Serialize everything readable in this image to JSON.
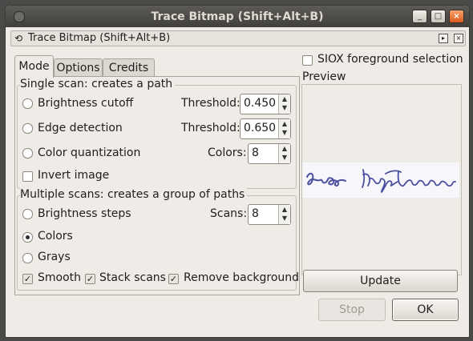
{
  "window": {
    "title": "Trace Bitmap (Shift+Alt+B)"
  },
  "titlebar_buttons": {
    "minimize": "_",
    "maximize": "□",
    "close": "×"
  },
  "dock": {
    "title": "Trace Bitmap (Shift+Alt+B)"
  },
  "tabs": [
    {
      "label": "Mode"
    },
    {
      "label": "Options"
    },
    {
      "label": "Credits"
    }
  ],
  "single_scan": {
    "title": "Single scan: creates a path",
    "brightness": {
      "label": "Brightness cutoff",
      "param_label": "Threshold:",
      "value": "0.450"
    },
    "edge": {
      "label": "Edge detection",
      "param_label": "Threshold:",
      "value": "0.650"
    },
    "color_quant": {
      "label": "Color quantization",
      "param_label": "Colors:",
      "value": "8"
    },
    "invert": {
      "label": "Invert image"
    }
  },
  "multiple_scans": {
    "title": "Multiple scans: creates a group of paths",
    "brightness_steps": {
      "label": "Brightness steps",
      "param_label": "Scans:",
      "value": "8"
    },
    "colors": {
      "label": "Colors",
      "selected": true
    },
    "grays": {
      "label": "Grays"
    },
    "smooth": {
      "label": "Smooth",
      "checked": true
    },
    "stack": {
      "label": "Stack scans",
      "checked": true
    },
    "remove_bg": {
      "label": "Remove background",
      "checked": true
    }
  },
  "siox": {
    "label": "SIOX foreground selection",
    "checked": false
  },
  "preview": {
    "title": "Preview",
    "update_label": "Update"
  },
  "actions": {
    "stop_label": "Stop",
    "ok_label": "OK"
  },
  "colors": {
    "signature_ink": "#4a4fa0",
    "titlebar": "#4c4b47",
    "close": "#e0652a"
  }
}
